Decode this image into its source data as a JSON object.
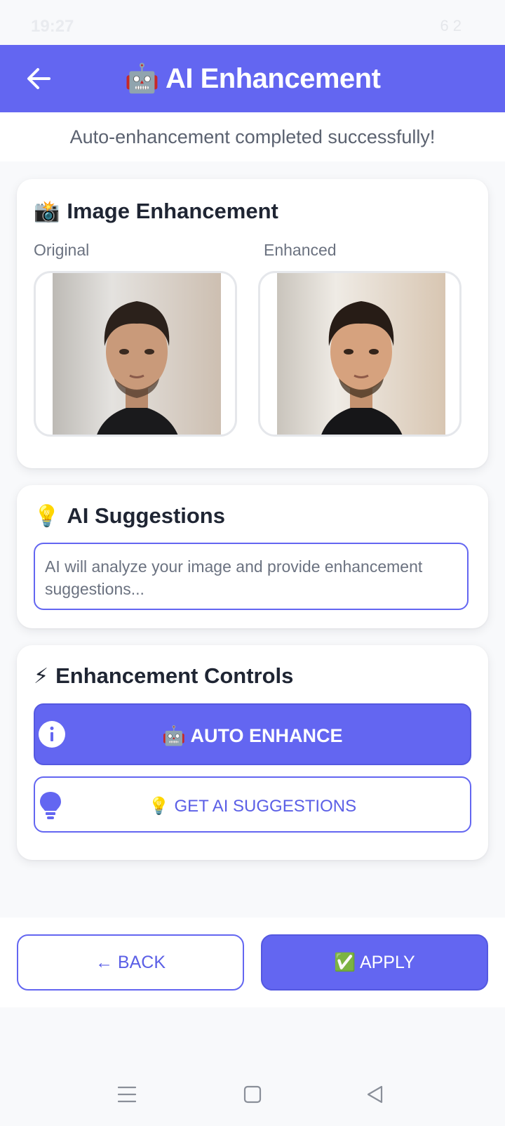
{
  "status_bar": {
    "time": "19:27",
    "battery": "62",
    "icons": [
      "mute-icon",
      "bluetooth-icon",
      "wifi-icon",
      "signal-icon",
      "battery-icon"
    ]
  },
  "header": {
    "title": "🤖 AI Enhancement",
    "back_icon": "arrow-left-icon",
    "background": "#6366f1"
  },
  "status_message": "Auto-enhancement completed successfully!",
  "image_card": {
    "title": "Image Enhancement",
    "title_emoji": "📸",
    "original_label": "Original",
    "enhanced_label": "Enhanced"
  },
  "suggestions_card": {
    "title": "AI Suggestions",
    "title_emoji": "💡",
    "placeholder": "AI will analyze your image and provide enhancement suggestions..."
  },
  "controls_card": {
    "title": "Enhancement Controls",
    "title_emoji": "⚡",
    "auto_enhance_label": "🤖 AUTO ENHANCE",
    "auto_enhance_icon": "info-icon",
    "suggestions_label": "💡 GET AI SUGGESTIONS",
    "suggestions_icon": "lightbulb-icon"
  },
  "footer": {
    "back_label": "← BACK",
    "apply_label": "✅ APPLY"
  },
  "nav_bar": {
    "icons": [
      "menu-icon",
      "home-icon",
      "back-triangle-icon"
    ]
  },
  "colors": {
    "accent": "#6366f1",
    "text": "#1f2533",
    "muted": "#6b7280"
  }
}
